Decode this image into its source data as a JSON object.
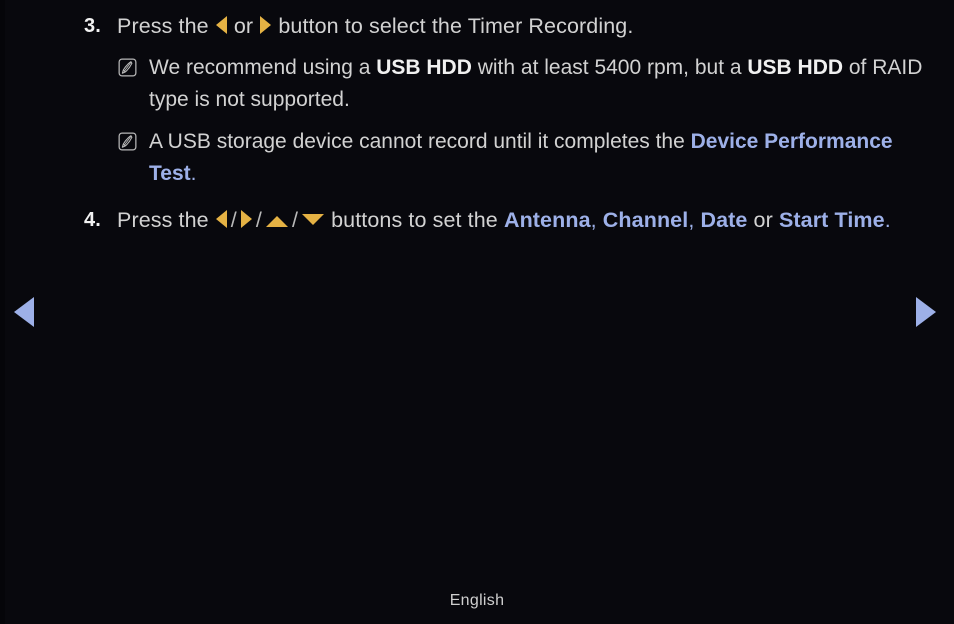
{
  "page": {
    "background_color": "#08080d",
    "body_text_color": "#d2d2d2",
    "bold_text_color": "#f0f0f0",
    "highlight_color": "#9db0e8",
    "arrow_gold_color": "#e5b244",
    "nav_arrow_color": "#9db0e8"
  },
  "steps": [
    {
      "number": "3.",
      "parts": {
        "t1": "Press the ",
        "icon1": "arrow-left-icon",
        "t2": " or ",
        "icon2": "arrow-right-icon",
        "t3": " button to select the Timer Recording."
      }
    },
    {
      "number": "4.",
      "parts": {
        "t1": "Press the ",
        "icon1": "arrow-left-icon",
        "sep1": "/",
        "icon2": "arrow-right-icon",
        "sep2": "/",
        "icon3": "arrow-up-icon",
        "sep3": "/",
        "icon4": "arrow-down-icon",
        "t2": " buttons to set the ",
        "hl1": "Antenna",
        "t3": ", ",
        "hl2": "Channel",
        "t4": ", ",
        "hl3": "Date",
        "t5": " or ",
        "hl4": "Start Time",
        "t6": "."
      }
    }
  ],
  "notes": [
    {
      "icon": "note-pencil-icon",
      "parts": {
        "t1": "We recommend using a ",
        "b1": "USB HDD",
        "t2": " with at least 5400 rpm, but a ",
        "b2": "USB HDD",
        "t3": " of RAID type is not supported."
      }
    },
    {
      "icon": "note-pencil-icon",
      "parts": {
        "t1": "A USB storage device cannot record until it completes the ",
        "hl1": "Device Performance Test",
        "t2": "."
      }
    }
  ],
  "navigation": {
    "prev": "prev-page-arrow",
    "next": "next-page-arrow"
  },
  "footer": {
    "language": "English"
  }
}
